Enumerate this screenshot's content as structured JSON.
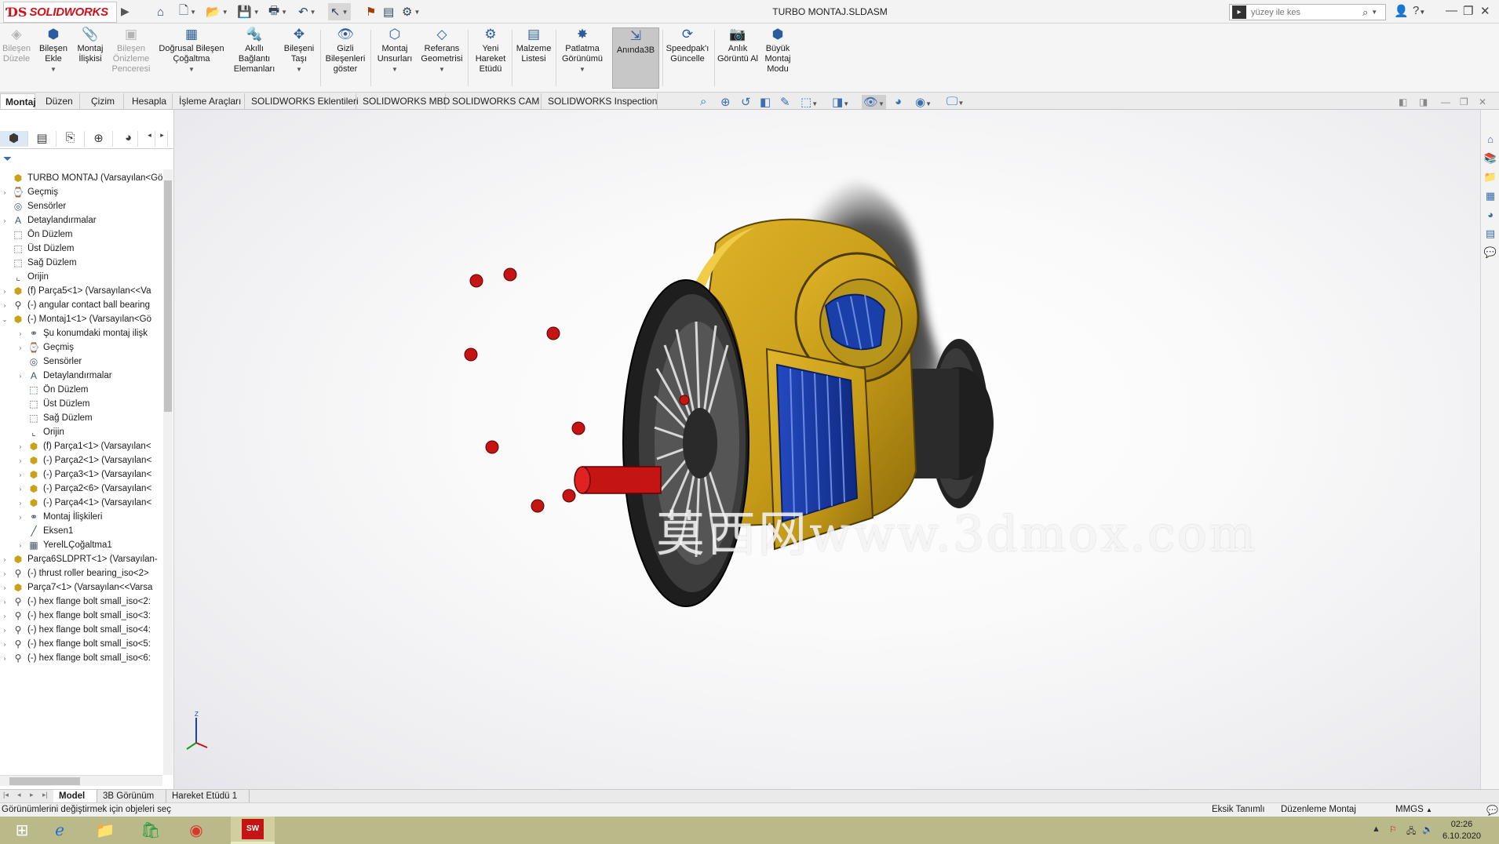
{
  "app": {
    "brand": "SOLIDWORKS",
    "doc_title": "TURBO MONTAJ.SLDASM"
  },
  "search": {
    "placeholder": "yüzey ile kes"
  },
  "commands": [
    {
      "label": "Bileşen Düzele",
      "icon": "component-edit-icon",
      "disabled": true
    },
    {
      "label": "Bileşen Ekle",
      "icon": "insert-component-icon"
    },
    {
      "label": "Montaj İlişkisi",
      "icon": "mate-icon"
    },
    {
      "label": "Bileşen Önizleme Penceresi",
      "icon": "preview-window-icon",
      "disabled": true
    },
    {
      "label": "Doğrusal Bileşen Çoğaltma",
      "icon": "linear-pattern-icon"
    },
    {
      "label": "Akıllı Bağlantı Elemanları",
      "icon": "smart-fasteners-icon"
    },
    {
      "label": "Bileşeni Taşı",
      "icon": "move-component-icon"
    },
    {
      "label": "Gizli Bileşenleri göster",
      "icon": "show-hidden-icon"
    },
    {
      "label": "Montaj Unsurları",
      "icon": "assembly-features-icon"
    },
    {
      "label": "Referans Geometrisi",
      "icon": "reference-geometry-icon"
    },
    {
      "label": "Yeni Hareket Etüdü",
      "icon": "motion-study-icon"
    },
    {
      "label": "Malzeme Listesi",
      "icon": "bom-icon"
    },
    {
      "label": "Patlatma Görünümü",
      "icon": "exploded-view-icon"
    },
    {
      "label": "Anında3B",
      "icon": "instant3d-icon",
      "active": true
    },
    {
      "label": "Speedpak'ı Güncelle",
      "icon": "speedpak-icon"
    },
    {
      "label": "Anlık Görüntü Al",
      "icon": "snapshot-icon"
    },
    {
      "label": "Büyük Montaj Modu",
      "icon": "large-assembly-icon"
    }
  ],
  "tabs": [
    "Montaj",
    "Düzen",
    "Çizim",
    "Hesapla",
    "İşleme Araçları",
    "SOLIDWORKS Eklentileri",
    "SOLIDWORKS MBD",
    "SOLIDWORKS CAM",
    "SOLIDWORKS Inspection"
  ],
  "tree": [
    {
      "label": "TURBO MONTAJ  (Varsayılan<Görü",
      "icon": "assembly-icon",
      "level": 0,
      "expander": ""
    },
    {
      "label": "Geçmiş",
      "icon": "history-icon",
      "level": 0,
      "expander": "›"
    },
    {
      "label": "Sensörler",
      "icon": "sensors-icon",
      "level": 0,
      "expander": ""
    },
    {
      "label": "Detaylandırmalar",
      "icon": "annotations-icon",
      "level": 0,
      "expander": "›"
    },
    {
      "label": "Ön Düzlem",
      "icon": "plane-icon",
      "level": 0,
      "expander": ""
    },
    {
      "label": "Üst Düzlem",
      "icon": "plane-icon",
      "level": 0,
      "expander": ""
    },
    {
      "label": "Sağ Düzlem",
      "icon": "plane-icon",
      "level": 0,
      "expander": ""
    },
    {
      "label": "Orijin",
      "icon": "origin-icon",
      "level": 0,
      "expander": ""
    },
    {
      "label": "(f) Parça5<1> (Varsayılan<<Va",
      "icon": "part-icon",
      "level": 0,
      "expander": "›"
    },
    {
      "label": "(-) angular contact ball bearing",
      "icon": "toolbox-part-icon",
      "level": 0,
      "expander": "›"
    },
    {
      "label": "(-) Montaj1<1> (Varsayılan<Gö",
      "icon": "subassembly-icon",
      "level": 0,
      "expander": "⌄"
    },
    {
      "label": "Şu konumdaki montaj ilişk",
      "icon": "mates-folder-icon",
      "level": 1,
      "expander": "›"
    },
    {
      "label": "Geçmiş",
      "icon": "history-icon",
      "level": 1,
      "expander": "›"
    },
    {
      "label": "Sensörler",
      "icon": "sensors-icon",
      "level": 1,
      "expander": ""
    },
    {
      "label": "Detaylandırmalar",
      "icon": "annotations-icon",
      "level": 1,
      "expander": "›"
    },
    {
      "label": "Ön Düzlem",
      "icon": "plane-icon",
      "level": 1,
      "expander": ""
    },
    {
      "label": "Üst Düzlem",
      "icon": "plane-icon",
      "level": 1,
      "expander": ""
    },
    {
      "label": "Sağ Düzlem",
      "icon": "plane-icon",
      "level": 1,
      "expander": ""
    },
    {
      "label": "Orijin",
      "icon": "origin-icon",
      "level": 1,
      "expander": ""
    },
    {
      "label": "(f) Parça1<1> (Varsayılan<",
      "icon": "part-icon",
      "level": 1,
      "expander": "›"
    },
    {
      "label": "(-) Parça2<1> (Varsayılan<",
      "icon": "part-icon",
      "level": 1,
      "expander": "›"
    },
    {
      "label": "(-) Parça3<1> (Varsayılan<",
      "icon": "part-icon",
      "level": 1,
      "expander": "›"
    },
    {
      "label": "(-) Parça2<6> (Varsayılan<",
      "icon": "part-icon",
      "level": 1,
      "expander": "›"
    },
    {
      "label": "(-) Parça4<1> (Varsayılan<",
      "icon": "part-icon",
      "level": 1,
      "expander": "›"
    },
    {
      "label": "Montaj İlişkileri",
      "icon": "mates-folder-icon",
      "level": 1,
      "expander": "›"
    },
    {
      "label": "Eksen1",
      "icon": "axis-icon",
      "level": 1,
      "expander": ""
    },
    {
      "label": "YerelLÇoğaltma1",
      "icon": "local-pattern-icon",
      "level": 1,
      "expander": "›"
    },
    {
      "label": "Parça6SLDPRT<1> (Varsayılan-",
      "icon": "part-icon",
      "level": 0,
      "expander": "›"
    },
    {
      "label": "(-) thrust roller bearing_iso<2>",
      "icon": "toolbox-part-icon",
      "level": 0,
      "expander": "›"
    },
    {
      "label": "Parça7<1> (Varsayılan<<Varsa",
      "icon": "part-icon",
      "level": 0,
      "expander": "›"
    },
    {
      "label": "(-) hex flange bolt small_iso<2:",
      "icon": "toolbox-part-icon",
      "level": 0,
      "expander": "›"
    },
    {
      "label": "(-) hex flange bolt small_iso<3:",
      "icon": "toolbox-part-icon",
      "level": 0,
      "expander": "›"
    },
    {
      "label": "(-) hex flange bolt small_iso<4:",
      "icon": "toolbox-part-icon",
      "level": 0,
      "expander": "›"
    },
    {
      "label": "(-) hex flange bolt small_iso<5:",
      "icon": "toolbox-part-icon",
      "level": 0,
      "expander": "›"
    },
    {
      "label": "(-) hex flange bolt small_iso<6:",
      "icon": "toolbox-part-icon",
      "level": 0,
      "expander": "›"
    }
  ],
  "watermark": "莫西网www.3dmox.com",
  "bottom_tabs": [
    "Model",
    "3B Görünüm",
    "Hareket Etüdü 1"
  ],
  "status": {
    "message": "Görünümlerini değiştirmek için objeleri seç",
    "definition": "Eksik Tanımlı",
    "mode": "Düzenleme Montaj",
    "units": "MMGS"
  },
  "clock": {
    "time": "02:26",
    "date": "6.10.2020"
  },
  "colors": {
    "brand_red": "#d0121b",
    "housing_gold": "#c9a21a",
    "coil_blue": "#1a3fa8",
    "bolt_red": "#c41414",
    "taskbar": "#b9b98a"
  }
}
